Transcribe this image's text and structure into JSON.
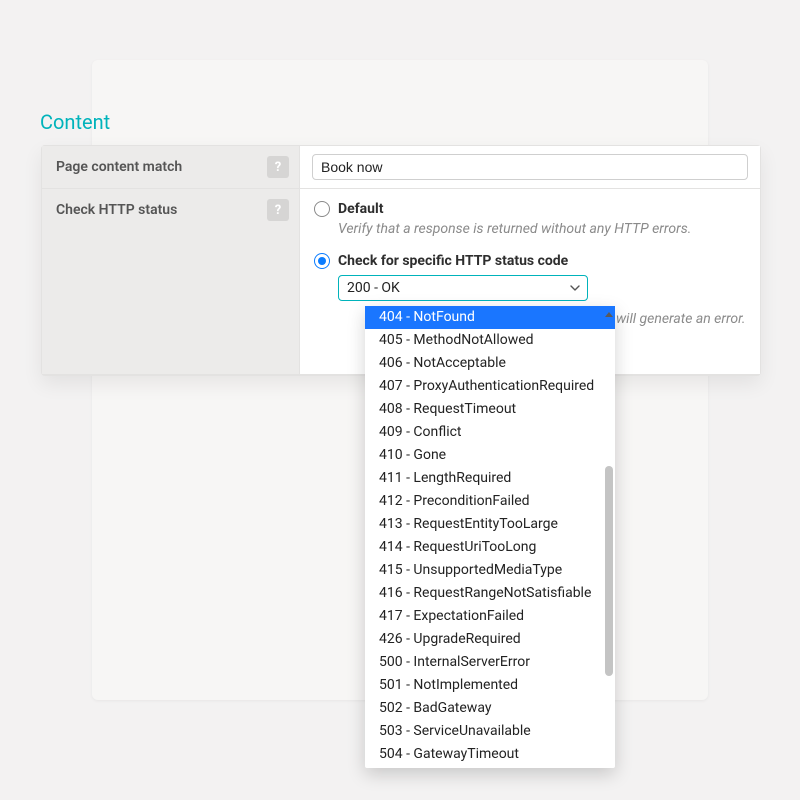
{
  "section_title": "Content",
  "help_glyph": "?",
  "rows": {
    "page_content_match": {
      "label": "Page content match",
      "value": "Book now"
    },
    "check_http_status": {
      "label": "Check HTTP status",
      "options": {
        "default": {
          "label": "Default",
          "description": "Verify that a response is returned without any HTTP errors."
        },
        "specific": {
          "label": "Check for specific HTTP status code",
          "selected_value": "200 - OK",
          "description_tail": "ed, will generate an error."
        }
      },
      "selected": "specific"
    }
  },
  "dropdown": {
    "highlighted_index": 0,
    "items": [
      "404 - NotFound",
      "405 - MethodNotAllowed",
      "406 - NotAcceptable",
      "407 - ProxyAuthenticationRequired",
      "408 - RequestTimeout",
      "409 -  Conflict",
      "410 - Gone",
      "411 - LengthRequired",
      "412 - PreconditionFailed",
      "413 - RequestEntityTooLarge",
      "414 - RequestUriTooLong",
      "415 - UnsupportedMediaType",
      "416 - RequestRangeNotSatisfiable",
      "417 - ExpectationFailed",
      "426 - UpgradeRequired",
      "500 - InternalServerError",
      "501 - NotImplemented",
      "502 - BadGateway",
      "503 - ServiceUnavailable",
      "504 - GatewayTimeout"
    ]
  }
}
